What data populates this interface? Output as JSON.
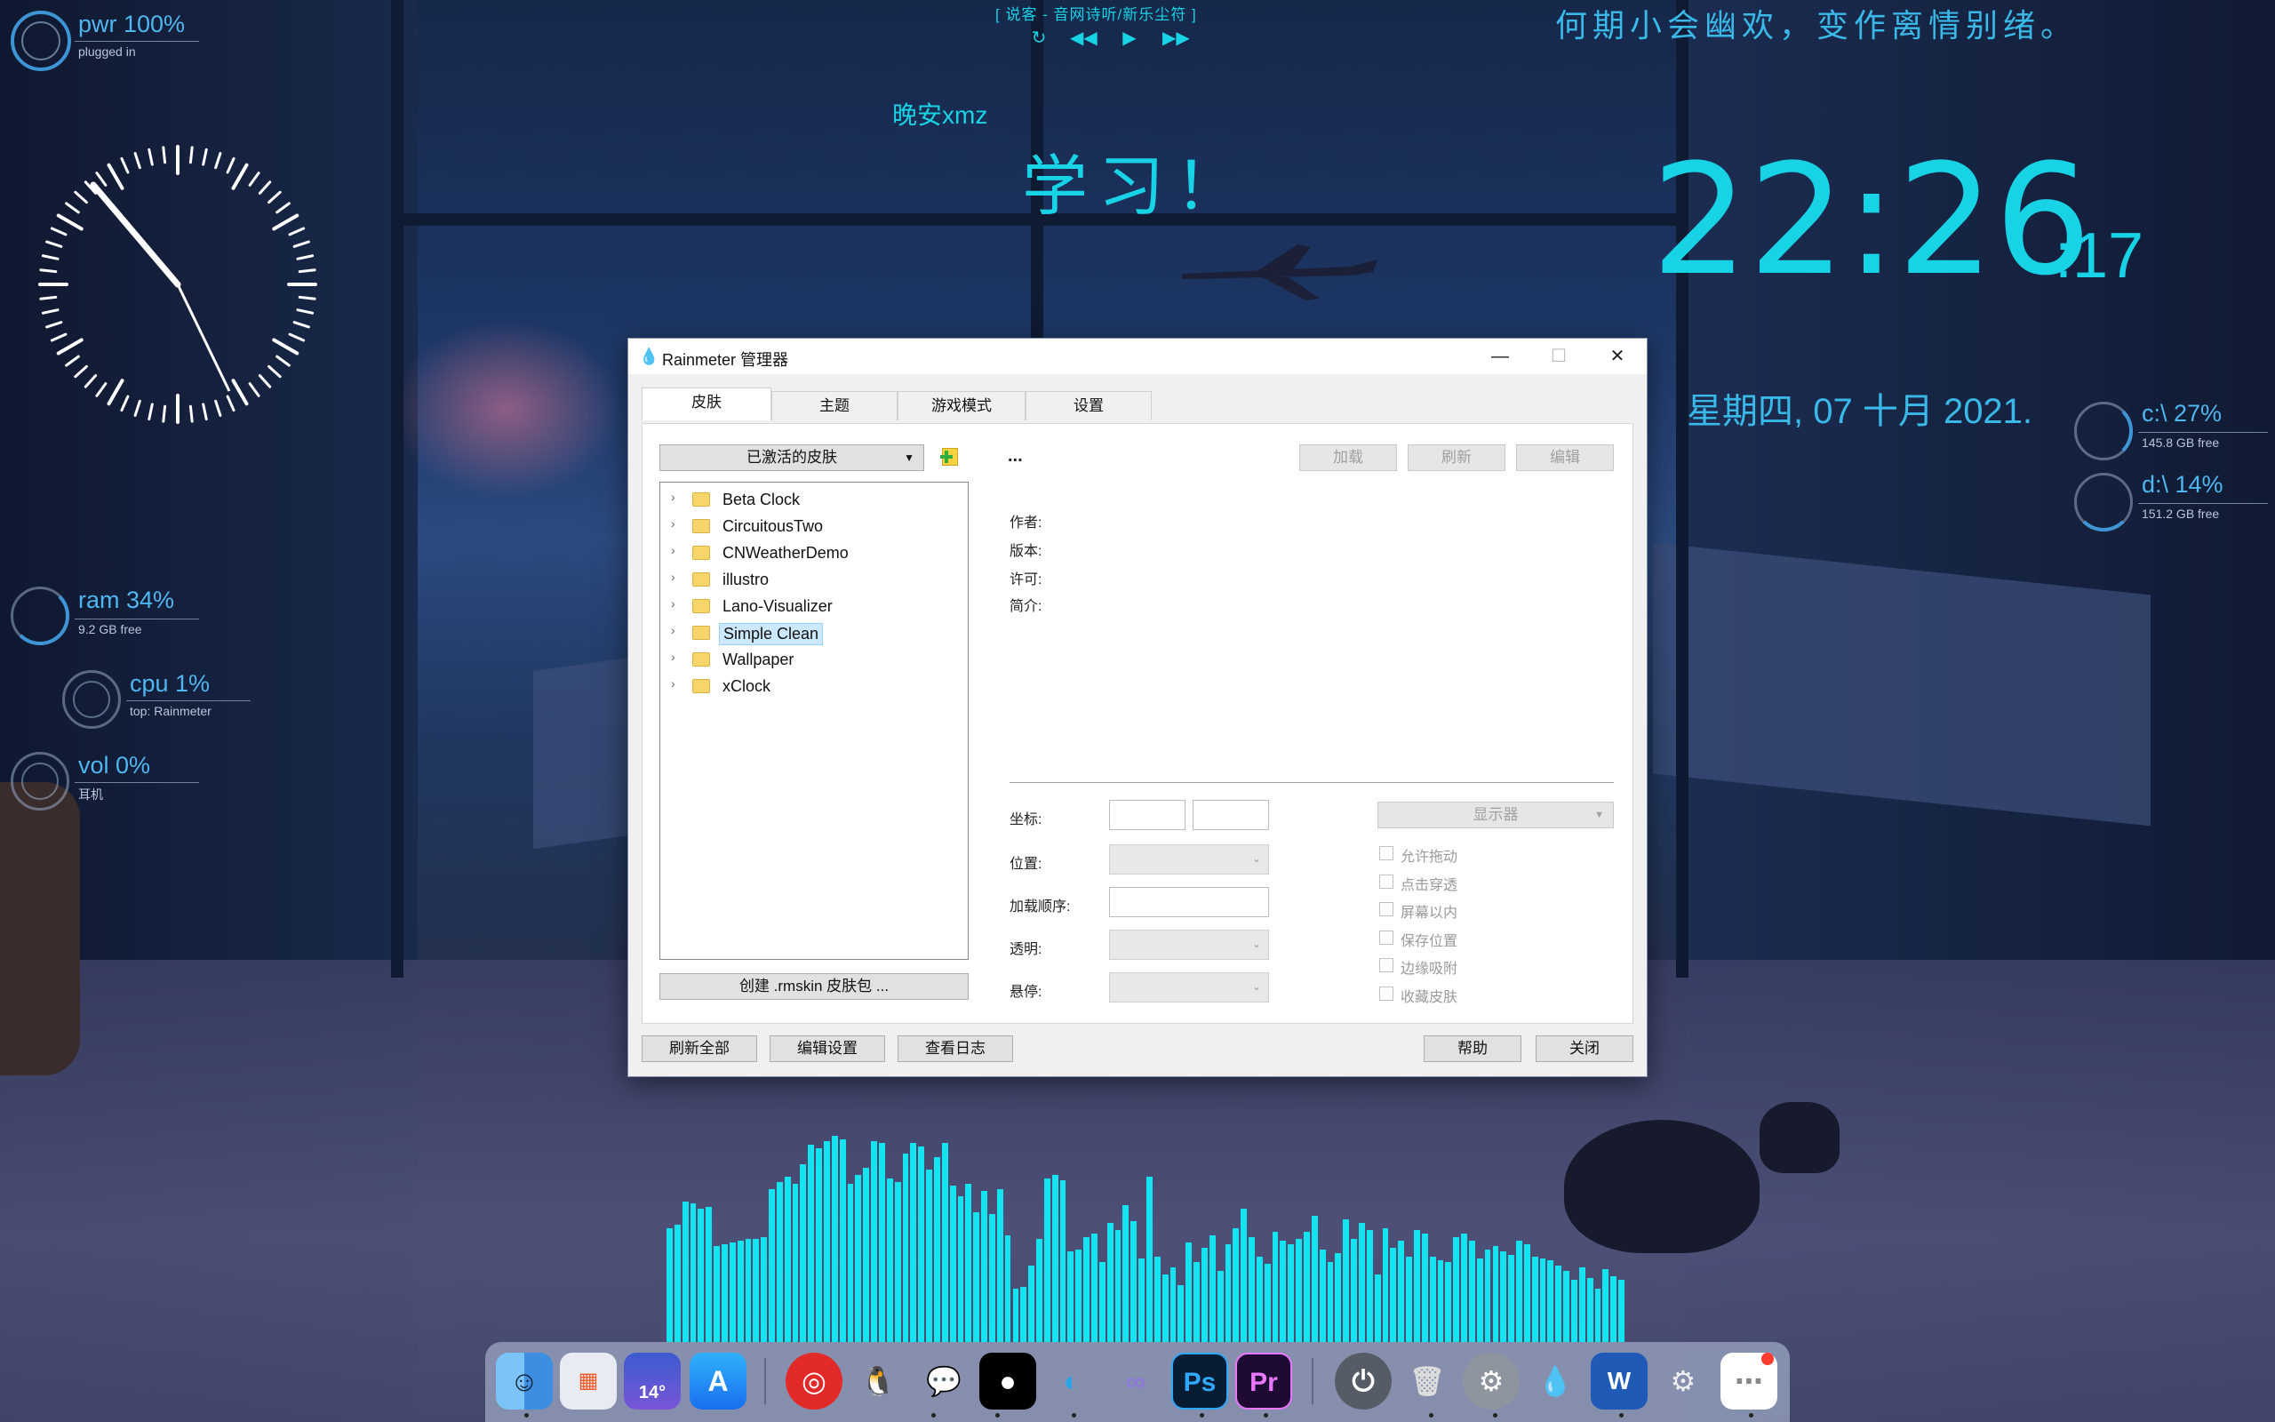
{
  "media": {
    "title": "[ 说客 - 音网诗听/新乐尘符 ]",
    "buttons": [
      "loop-icon",
      "prev-icon",
      "play-icon",
      "next-icon"
    ]
  },
  "quote": "何期小会幽欢，变作离情别绪。",
  "greeting": "晚安xmz",
  "motto": "学习！",
  "clock": {
    "time": "22:26",
    "seconds": ":17",
    "date": "星期四, 07 十月 2021."
  },
  "power": {
    "label": "pwr 100%",
    "sub": "plugged in"
  },
  "ram": {
    "label": "ram 34%",
    "sub": "9.2 GB free",
    "pct": 34
  },
  "cpu": {
    "label": "cpu 1%",
    "sub": "top: Rainmeter",
    "pct": 1
  },
  "vol": {
    "label": "vol 0%",
    "sub": "耳机",
    "pct": 0
  },
  "drive_c": {
    "label": "c:\\ 27%",
    "sub": "145.8 GB free",
    "pct": 27
  },
  "drive_d": {
    "label": "d:\\ 14%",
    "sub": "151.2 GB free",
    "pct": 14
  },
  "window": {
    "title": "Rainmeter 管理器",
    "tabs": [
      "皮肤",
      "主题",
      "游戏模式",
      "设置"
    ],
    "active_tab": 0,
    "skins_dropdown": "已激活的皮肤",
    "skin_name": "...",
    "skins": [
      "Beta Clock",
      "CircuitousTwo",
      "CNWeatherDemo",
      "illustro",
      "Lano-Visualizer",
      "Simple Clean",
      "Wallpaper",
      "xClock"
    ],
    "selected_skin": "Simple Clean",
    "buttons": {
      "load": "加载",
      "refresh": "刷新",
      "edit": "编辑",
      "create": "创建 .rmskin 皮肤包 ...",
      "refresh_all": "刷新全部",
      "edit_settings": "编辑设置",
      "view_log": "查看日志",
      "help": "帮助",
      "close": "关闭"
    },
    "meta": {
      "author": "作者:",
      "version": "版本:",
      "license": "许可:",
      "description": "简介:"
    },
    "fields": {
      "coords": "坐标:",
      "position": "位置:",
      "load_order": "加载顺序:",
      "transparency": "透明:",
      "hover": "悬停:",
      "display": "显示器"
    },
    "checkboxes": [
      "允许拖动",
      "点击穿透",
      "屏幕以内",
      "保存位置",
      "边缘吸附",
      "收藏皮肤"
    ]
  },
  "dock": {
    "weather_temp": "14°",
    "apps": [
      "finder-icon",
      "launchpad-icon",
      "weather-icon",
      "app-store-icon",
      "netease-music-icon",
      "qq-icon",
      "wechat-icon",
      "notion-icon",
      "edge-icon",
      "infinity-icon",
      "photoshop-icon",
      "premiere-icon",
      "power-icon",
      "trash-icon",
      "system-preferences-icon",
      "rainmeter-icon",
      "word-icon",
      "settings-icon",
      "more-icon"
    ],
    "ps_label": "Ps",
    "pr_label": "Pr",
    "word_label": "W"
  },
  "visualizer": {
    "bars": [
      128,
      132,
      158,
      156,
      150,
      152,
      108,
      110,
      112,
      114,
      116,
      116,
      118,
      172,
      180,
      186,
      178,
      200,
      222,
      218,
      226,
      232,
      228,
      178,
      188,
      196,
      226,
      224,
      184,
      180,
      212,
      224,
      220,
      194,
      208,
      224,
      176,
      164,
      178,
      146,
      170,
      144,
      172,
      120,
      60,
      62,
      86,
      116,
      184,
      188,
      182,
      102,
      104,
      118,
      122,
      90,
      134,
      126,
      154,
      136,
      94,
      186,
      96,
      76,
      84,
      64,
      112,
      90,
      106,
      120,
      80,
      110,
      128,
      150,
      118,
      96,
      88,
      124,
      114,
      110,
      116,
      124,
      142,
      104,
      90,
      100,
      138,
      116,
      134,
      126,
      76,
      128,
      106,
      114,
      96,
      126,
      122,
      96,
      92,
      90,
      118,
      122,
      114,
      94,
      104,
      108,
      102,
      98,
      114,
      110,
      96,
      94,
      92,
      86,
      80,
      70,
      84,
      72,
      60,
      82,
      74,
      70
    ]
  }
}
